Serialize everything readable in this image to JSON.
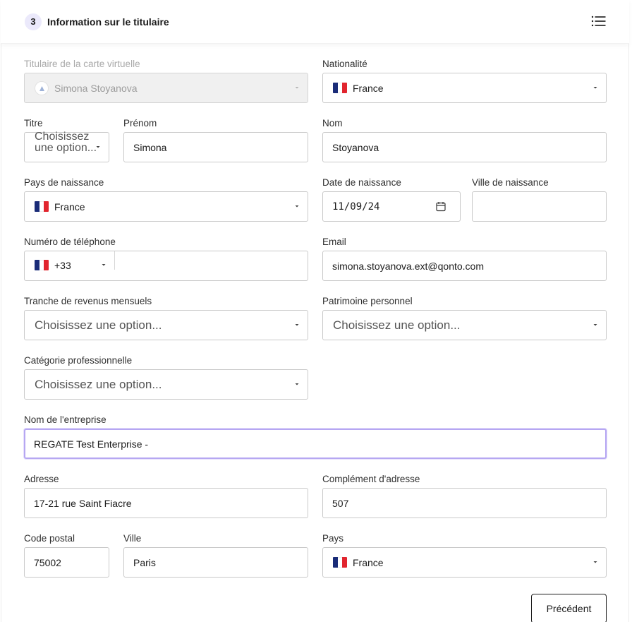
{
  "header": {
    "step_number": "3",
    "title": "Information sur le titulaire"
  },
  "form": {
    "card_holder": {
      "label": "Titulaire de la carte virtuelle",
      "value": "Simona Stoyanova"
    },
    "nationality": {
      "label": "Nationalité",
      "value": "France"
    },
    "title": {
      "label": "Titre",
      "placeholder": "Choisissez une option..."
    },
    "first_name": {
      "label": "Prénom",
      "value": "Simona"
    },
    "last_name": {
      "label": "Nom",
      "value": "Stoyanova"
    },
    "birth_country": {
      "label": "Pays de naissance",
      "value": "France"
    },
    "birth_date": {
      "label": "Date de naissance",
      "value": "11/09/24"
    },
    "birth_city": {
      "label": "Ville de naissance",
      "value": ""
    },
    "phone": {
      "label": "Numéro de téléphone",
      "prefix": "+33",
      "value": ""
    },
    "email": {
      "label": "Email",
      "value": "simona.stoyanova.ext@qonto.com"
    },
    "monthly_income": {
      "label": "Tranche de revenus mensuels",
      "placeholder": "Choisissez une option..."
    },
    "personal_assets": {
      "label": "Patrimoine personnel",
      "placeholder": "Choisissez une option..."
    },
    "professional_category": {
      "label": "Catégorie professionnelle",
      "placeholder": "Choisissez une option..."
    },
    "company_name": {
      "label": "Nom de l'entreprise",
      "value": "REGATE Test Enterprise -"
    },
    "address": {
      "label": "Adresse",
      "value": "17-21 rue Saint Fiacre"
    },
    "address_complement": {
      "label": "Complément d'adresse",
      "value": "507"
    },
    "postal_code": {
      "label": "Code postal",
      "value": "75002"
    },
    "city": {
      "label": "Ville",
      "value": "Paris"
    },
    "country": {
      "label": "Pays",
      "value": "France"
    }
  },
  "actions": {
    "previous_label": "Précédent"
  },
  "icons": {
    "menu": "list-icon",
    "chevron": "chevron-down-icon",
    "calendar": "calendar-icon",
    "flag": "france-flag-icon"
  },
  "colors": {
    "focus_border": "#b6a7f2",
    "step_badge_bg": "#ebe9fb"
  }
}
